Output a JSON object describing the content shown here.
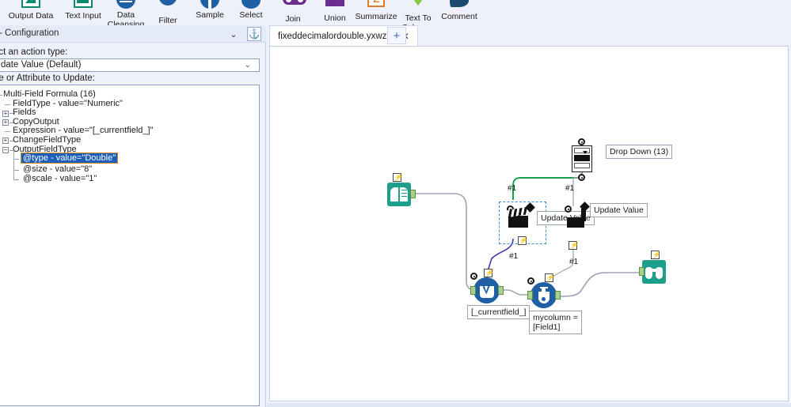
{
  "toolbar": {
    "tools": [
      {
        "label": "Output Data",
        "icon": "output-data-icon"
      },
      {
        "label": "Text Input",
        "icon": "text-input-icon"
      },
      {
        "label": "Data\nCleansing",
        "icon": "data-cleansing-icon"
      },
      {
        "label": "Filter",
        "icon": "filter-icon"
      },
      {
        "label": "Sample",
        "icon": "sample-icon"
      },
      {
        "label": "Select",
        "icon": "select-icon"
      },
      {
        "label": "Join",
        "icon": "join-icon"
      },
      {
        "label": "Union",
        "icon": "union-icon"
      },
      {
        "label": "Summarize",
        "icon": "summarize-icon"
      },
      {
        "label": "Text To\nColumns",
        "icon": "text-to-columns-icon"
      },
      {
        "label": "Comment",
        "icon": "comment-icon"
      }
    ]
  },
  "config": {
    "title": ") - Configuration",
    "collapse_glyph": "⌄",
    "pin_glyph": "⚓",
    "action_type_label": "ect an action type:",
    "action_type_value": "date Value (Default)",
    "action_type_arrow": "⌄",
    "value_attr_label": "ue or Attribute to Update:",
    "tree": [
      {
        "text": "Multi-Field Formula (16)",
        "indent": 0,
        "expander": "-",
        "selected": false
      },
      {
        "text": "FieldType - value=\"Numeric\"",
        "indent": 1,
        "expander": "",
        "selected": false
      },
      {
        "text": "Fields",
        "indent": 1,
        "expander": "+",
        "selected": false
      },
      {
        "text": "CopyOutput",
        "indent": 1,
        "expander": "+",
        "selected": false
      },
      {
        "text": "Expression - value=\"[_currentfield_]\"",
        "indent": 1,
        "expander": "",
        "selected": false
      },
      {
        "text": "ChangeFieldType",
        "indent": 1,
        "expander": "+",
        "selected": false
      },
      {
        "text": "OutputFieldType",
        "indent": 1,
        "expander": "-",
        "selected": false
      },
      {
        "text": "@type - value=\"Double\"",
        "indent": 2,
        "expander": "",
        "selected": true
      },
      {
        "text": "@size - value=\"8\"",
        "indent": 2,
        "expander": "",
        "selected": false
      },
      {
        "text": "@scale - value=\"1\"",
        "indent": 2,
        "expander": "",
        "selected": false
      }
    ]
  },
  "tabs": {
    "document": "fixeddecimalordouble.yxwz*",
    "close_glyph": "✕",
    "new_tab_glyph": "+"
  },
  "canvas": {
    "nodes": [
      {
        "name": "drop-down-tool",
        "label": "Drop Down (13)"
      },
      {
        "name": "update-value-action-1",
        "label": "Update Value"
      },
      {
        "name": "update-value-action-2",
        "label": "Update Value"
      },
      {
        "name": "text-input-tool",
        "label": ""
      },
      {
        "name": "multi-field-formula-tool",
        "label": "[_currentfield_]"
      },
      {
        "name": "formula-tool",
        "label": "mycolumn =\n[Field1]"
      },
      {
        "name": "browse-tool",
        "label": ""
      }
    ],
    "wire_labels": [
      "#1",
      "#1",
      "#1",
      "#1",
      "#1"
    ],
    "lightning_glyph": "⚡"
  },
  "colors": {
    "accent_blue": "#1f5fa6",
    "teal": "#1b9e8a",
    "selection_blue": "#1c5fb8",
    "selection_outline": "#d98a22",
    "green_wire": "#16a34a",
    "purple_wire": "#3b3bb5",
    "panel_bg": "#eef1fa"
  }
}
